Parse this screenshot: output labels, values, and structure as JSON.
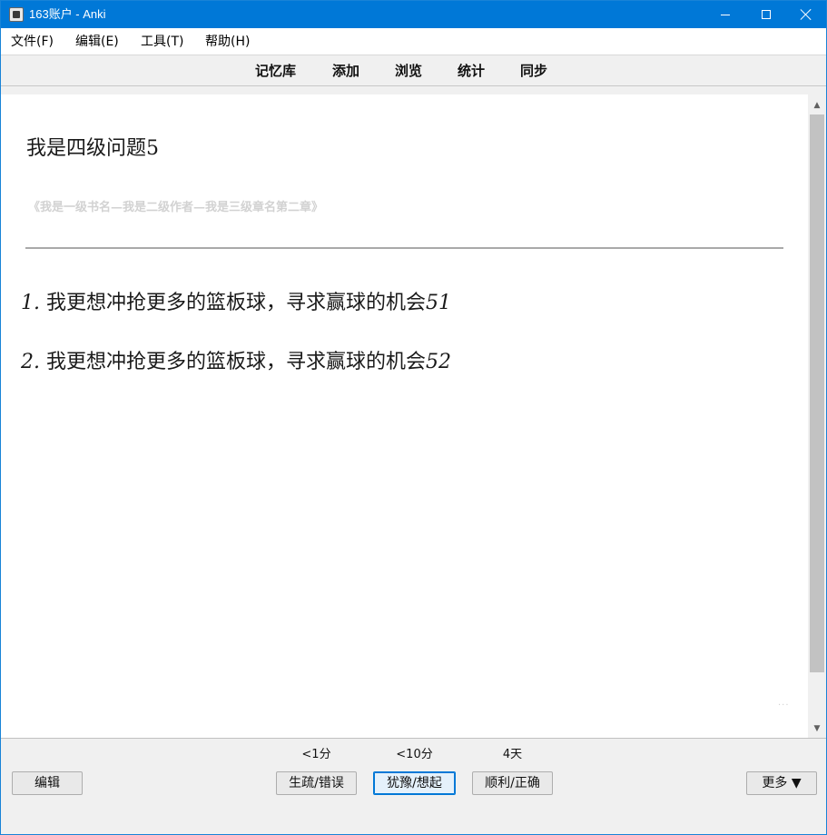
{
  "window": {
    "title": "163账户 - Anki"
  },
  "menu": {
    "items": [
      "文件(F)",
      "编辑(E)",
      "工具(T)",
      "帮助(H)"
    ]
  },
  "toolbar": {
    "links": [
      "记忆库",
      "添加",
      "浏览",
      "统计",
      "同步"
    ]
  },
  "card": {
    "question": "我是四级问题5",
    "source": "《我是一级书名—我是二级作者—我是三级章名第二章》",
    "answers": [
      {
        "num": "1.",
        "text": "我更想冲抢更多的篮板球，寻求赢球的机会",
        "tail": "51"
      },
      {
        "num": "2.",
        "text": "我更想冲抢更多的篮板球，寻求赢球的机会",
        "tail": "52"
      }
    ],
    "dots": "..."
  },
  "bottom": {
    "edit_label": "编辑",
    "more_label": "更多 ▼",
    "answer_buttons": [
      {
        "due": "<1分",
        "label": "生疏/错误"
      },
      {
        "due": "<10分",
        "label": "犹豫/想起"
      },
      {
        "due": "4天",
        "label": "顺利/正确"
      }
    ]
  }
}
